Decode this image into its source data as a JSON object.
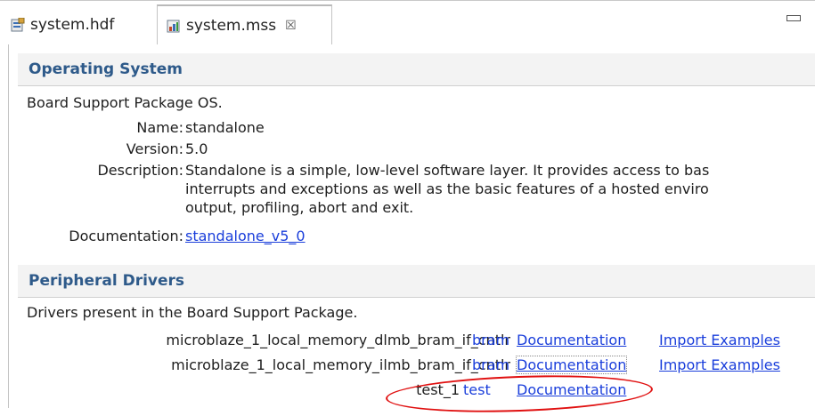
{
  "tabs": [
    {
      "label": "system.hdf",
      "icon": "hdf-file-icon"
    },
    {
      "label": "system.mss",
      "icon": "mss-file-icon",
      "close": "☒"
    }
  ],
  "os_section": {
    "title": "Operating System",
    "intro": "Board Support Package OS.",
    "name_label": "Name:",
    "name_value": "standalone",
    "version_label": "Version:",
    "version_value": "5.0",
    "description_label": "Description:",
    "description_lines": [
      "Standalone is a simple, low-level software layer. It provides access to bas",
      "interrupts and exceptions as well as the basic features of a hosted enviro",
      "output, profiling, abort and exit."
    ],
    "doc_label": "Documentation:",
    "doc_link": "standalone_v5_0"
  },
  "drivers_section": {
    "title": "Peripheral Drivers",
    "intro": "Drivers present in the Board Support Package.",
    "rows": [
      {
        "name": "microblaze_1_local_memory_dlmb_bram_if_cntlr",
        "driver": "bram",
        "doc": "Documentation",
        "examples": "Import Examples"
      },
      {
        "name": "microblaze_1_local_memory_ilmb_bram_if_cntlr",
        "driver": "bram",
        "doc": "Documentation",
        "examples": "Import Examples"
      },
      {
        "name": "test_1",
        "driver": "test",
        "doc": "Documentation",
        "examples": ""
      }
    ]
  },
  "colors": {
    "link": "#1a3edb",
    "header_text": "#2e5a8a",
    "annotation": "#e01010"
  }
}
